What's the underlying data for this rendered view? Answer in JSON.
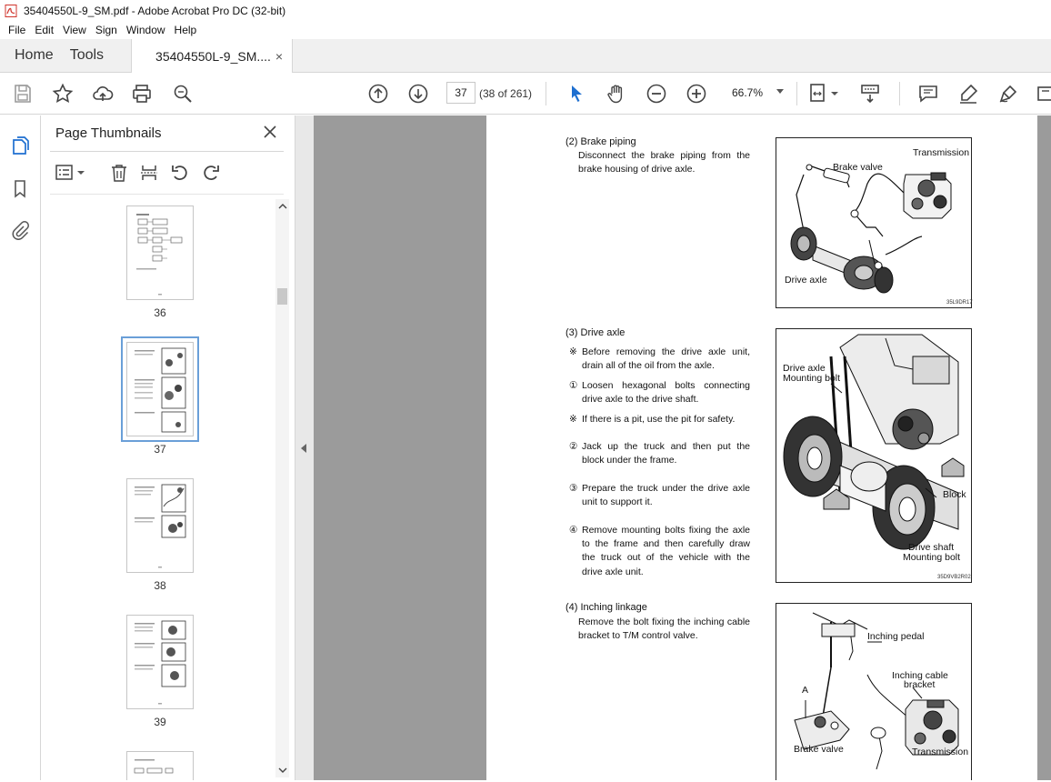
{
  "window": {
    "title": "35404550L-9_SM.pdf - Adobe Acrobat Pro DC (32-bit)"
  },
  "menu": [
    "File",
    "Edit",
    "View",
    "Sign",
    "Window",
    "Help"
  ],
  "tabs": {
    "home": "Home",
    "tools": "Tools",
    "document": "35404550L-9_SM....",
    "close": "×"
  },
  "toolbar": {
    "current_page": "37",
    "page_count": "(38 of 261)",
    "zoom": "66.7%"
  },
  "thumbnails_panel": {
    "title": "Page Thumbnails",
    "pages": [
      {
        "label": "36",
        "selected": false
      },
      {
        "label": "37",
        "selected": true
      },
      {
        "label": "38",
        "selected": false
      },
      {
        "label": "39",
        "selected": false
      }
    ]
  },
  "document": {
    "sections": [
      {
        "title": "(2) Brake piping",
        "text": "Disconnect the brake piping from the brake housing of drive axle."
      },
      {
        "title": "(3) Drive axle",
        "steps": [
          {
            "mark": "※",
            "text": "Before removing the drive axle unit, drain all of the oil from the axle."
          },
          {
            "mark": "①",
            "text": "Loosen hexagonal bolts connecting drive axle to the drive shaft."
          },
          {
            "mark": "※",
            "text": "If there is a pit, use the pit for safety."
          },
          {
            "mark": "②",
            "text": "Jack up the truck and then put the block under the frame."
          },
          {
            "mark": "③",
            "text": "Prepare the truck under the drive axle unit to support it."
          },
          {
            "mark": "④",
            "text": "Remove mounting bolts fixing the axle to the frame and then carefully draw the truck out of the vehicle with the drive axle unit."
          }
        ]
      },
      {
        "title": "(4) Inching linkage",
        "text": "Remove the bolt fixing the inching cable bracket to T/M control valve."
      }
    ],
    "figures": {
      "fig1": {
        "transmission": "Transmission",
        "brake_valve": "Brake valve",
        "drive_axle": "Drive axle",
        "code": "35L9DR17"
      },
      "fig2": {
        "mount1": "Drive axle",
        "mount2": "Mounting bolt",
        "block": "Block",
        "shaft1": "Drive shaft",
        "shaft2": "Mounting bolt",
        "code": "35D9VB2R02"
      },
      "fig3": {
        "inching_pedal": "Inching pedal",
        "bracket1": "Inching cable",
        "bracket2": "bracket",
        "a_mark": "A",
        "brake_valve": "Brake valve",
        "transmission": "Transmission"
      }
    }
  }
}
